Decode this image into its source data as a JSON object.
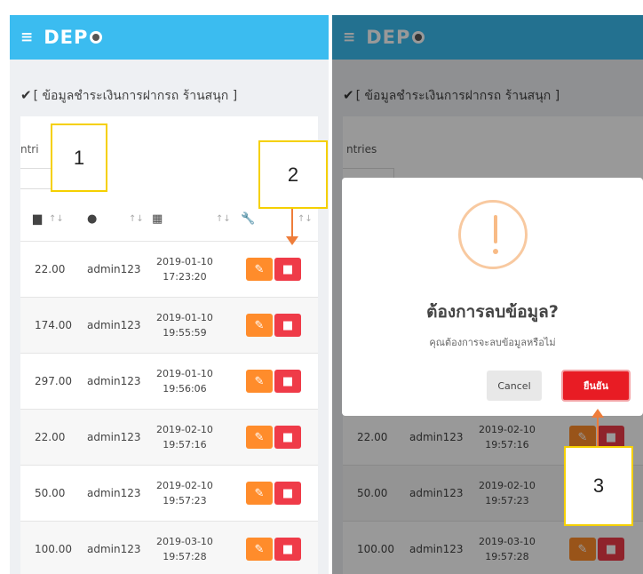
{
  "app": {
    "menu_icon": "≡",
    "logo_text": "DEP"
  },
  "section_title": "[ ข้อมูลชำระเงินการฝากรถ ร้านสนุก ]",
  "entries_left": "ntri",
  "entries_right": "ntries",
  "table": {
    "column_icons": [
      "money-icon",
      "user-icon",
      "calendar-icon",
      "wrench-icon"
    ],
    "sort_glyph": "↑↓",
    "rows": [
      {
        "amount": "22.00",
        "user": "admin123",
        "date": "2019-01-10",
        "time": "17:23:20"
      },
      {
        "amount": "174.00",
        "user": "admin123",
        "date": "2019-01-10",
        "time": "19:55:59"
      },
      {
        "amount": "297.00",
        "user": "admin123",
        "date": "2019-01-10",
        "time": "19:56:06"
      },
      {
        "amount": "22.00",
        "user": "admin123",
        "date": "2019-02-10",
        "time": "19:57:16"
      },
      {
        "amount": "50.00",
        "user": "admin123",
        "date": "2019-02-10",
        "time": "19:57:23"
      },
      {
        "amount": "100.00",
        "user": "admin123",
        "date": "2019-03-10",
        "time": "19:57:28"
      }
    ],
    "right_rows": [
      {
        "amount": "22.00",
        "user": "admin123",
        "date": "2019-02-10",
        "time": "19:57:16"
      },
      {
        "amount": "50.00",
        "user": "admin123",
        "date": "2019-02-10",
        "time": "19:57:23"
      },
      {
        "amount": "100.00",
        "user": "admin123",
        "date": "2019-03-10",
        "time": "19:57:28"
      }
    ]
  },
  "modal": {
    "title": "ต้องการลบข้อมูล?",
    "text": "คุณต้องการจะลบข้อมูลหรือไม่",
    "cancel_label": "Cancel",
    "confirm_label": "ยืนยัน"
  },
  "callouts": {
    "one": "1",
    "two": "2",
    "three": "3"
  },
  "colors": {
    "header": "#3bbcf0",
    "edit": "#ff8c2b",
    "delete": "#ef3b48",
    "confirm": "#e81c24",
    "callout_border": "#f5d000",
    "arrow": "#ee7d3b"
  }
}
